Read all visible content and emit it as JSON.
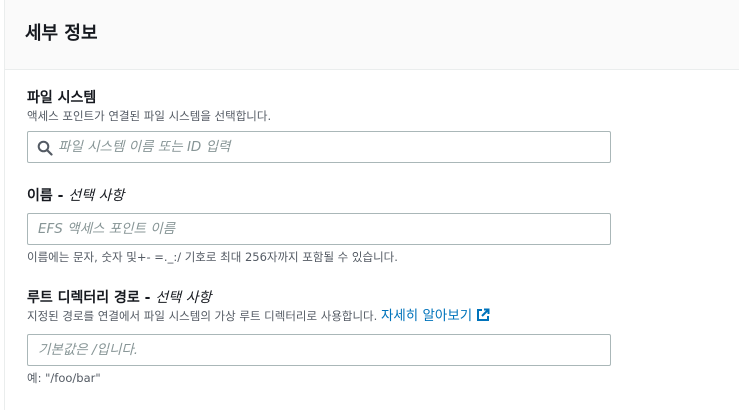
{
  "panel": {
    "title": "세부 정보"
  },
  "file_system": {
    "label": "파일 시스템",
    "description": "액세스 포인트가 연결된 파일 시스템을 선택합니다.",
    "placeholder": "파일 시스템 이름 또는 ID 입력",
    "value": "",
    "icon": "search-icon"
  },
  "name": {
    "label": "이름",
    "separator": " - ",
    "optional": "선택 사항",
    "placeholder": "EFS 액세스 포인트 이름",
    "value": "",
    "constraint": "이름에는 문자, 숫자 및+- =._:/ 기호로 최대 256자까지 포함될 수 있습니다."
  },
  "root_directory": {
    "label": "루트 디렉터리 경로",
    "separator": " - ",
    "optional": "선택 사항",
    "description": "지정된 경로를 연결에서 파일 시스템의 가상 루트 디렉터리로 사용합니다.",
    "learn_more": "자세히 알아보기",
    "learn_more_icon": "external-link-icon",
    "placeholder": "기본값은 /입니다.",
    "value": "",
    "example": "예: \"/foo/bar\""
  },
  "colors": {
    "link": "#0073bb",
    "border": "#aab7b8",
    "header_bg": "#fafafa",
    "text_secondary": "#545b64"
  }
}
